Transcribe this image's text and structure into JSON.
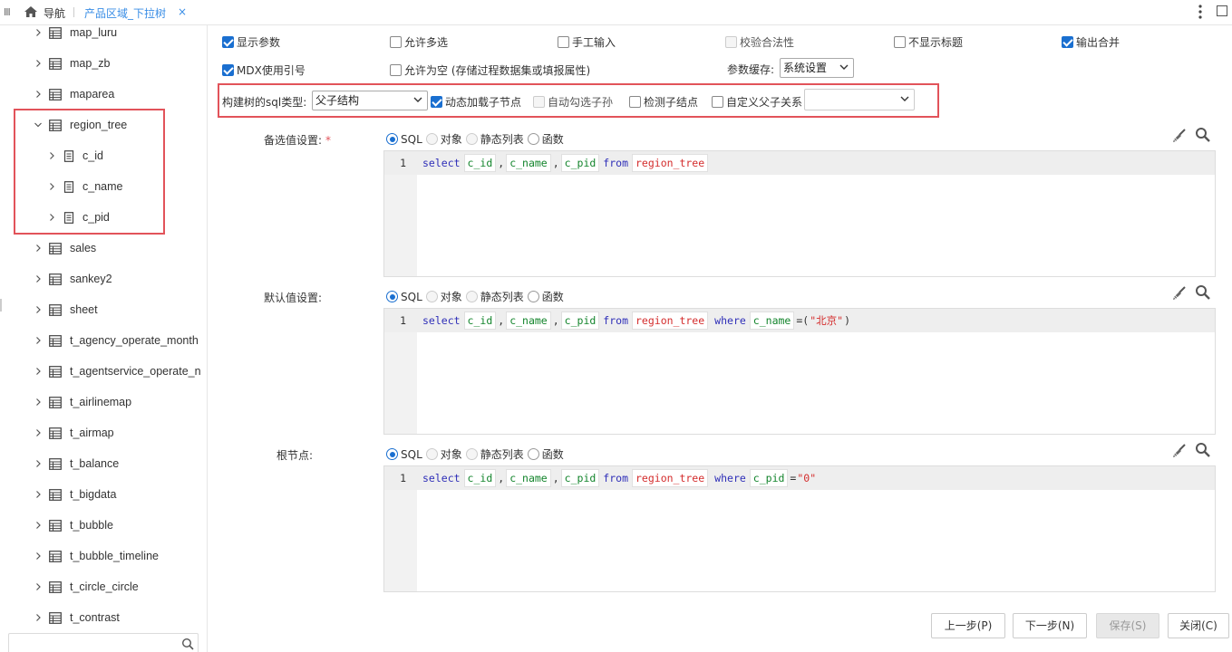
{
  "topbar": {
    "nav_label": "导航",
    "tab_label": "产品区域_下拉树",
    "tab_close": "×"
  },
  "tree": {
    "items": [
      {
        "label": "map_luru",
        "level": 0,
        "expanded": false
      },
      {
        "label": "map_zb",
        "level": 0,
        "expanded": false
      },
      {
        "label": "maparea",
        "level": 0,
        "expanded": false
      },
      {
        "label": "region_tree",
        "level": 0,
        "expanded": true
      },
      {
        "label": "c_id",
        "level": 1,
        "expanded": false
      },
      {
        "label": "c_name",
        "level": 1,
        "expanded": false
      },
      {
        "label": "c_pid",
        "level": 1,
        "expanded": false
      },
      {
        "label": "sales",
        "level": 0,
        "expanded": false
      },
      {
        "label": "sankey2",
        "level": 0,
        "expanded": false
      },
      {
        "label": "sheet",
        "level": 0,
        "expanded": false
      },
      {
        "label": "t_agency_operate_month",
        "level": 0,
        "expanded": false
      },
      {
        "label": "t_agentservice_operate_n",
        "level": 0,
        "expanded": false
      },
      {
        "label": "t_airlinemap",
        "level": 0,
        "expanded": false
      },
      {
        "label": "t_airmap",
        "level": 0,
        "expanded": false
      },
      {
        "label": "t_balance",
        "level": 0,
        "expanded": false
      },
      {
        "label": "t_bigdata",
        "level": 0,
        "expanded": false
      },
      {
        "label": "t_bubble",
        "level": 0,
        "expanded": false
      },
      {
        "label": "t_bubble_timeline",
        "level": 0,
        "expanded": false
      },
      {
        "label": "t_circle_circle",
        "level": 0,
        "expanded": false
      },
      {
        "label": "t_contrast",
        "level": 0,
        "expanded": false
      }
    ],
    "search_placeholder": ""
  },
  "options": {
    "show_param": {
      "label": "显示参数",
      "checked": true
    },
    "allow_multi": {
      "label": "允许多选",
      "checked": false
    },
    "manual_input": {
      "label": "手工输入",
      "checked": false
    },
    "validate": {
      "label": "校验合法性",
      "checked": false,
      "disabled": true
    },
    "hide_title": {
      "label": "不显示标题",
      "checked": false
    },
    "output_merge": {
      "label": "输出合并",
      "checked": true
    },
    "mdx_quote": {
      "label": "MDX使用引号",
      "checked": true
    },
    "allow_empty": {
      "label": "允许为空 (存储过程数据集或填报属性)",
      "checked": false
    },
    "cache_label": "参数缓存:",
    "cache_value": "系统设置"
  },
  "tree_row": {
    "sql_type_label": "构建树的sql类型:",
    "sql_type_value": "父子结构",
    "dynamic_load": {
      "label": "动态加载子节点",
      "checked": true
    },
    "auto_check": {
      "label": "自动勾选子孙",
      "checked": false,
      "disabled": true
    },
    "detect_leaf": {
      "label": "检测子结点",
      "checked": false
    },
    "custom_relation": {
      "label": "自定义父子关系",
      "checked": false
    },
    "custom_relation_value": ""
  },
  "sections": [
    {
      "label": "备选值设置:",
      "required": "*",
      "radios": [
        "SQL",
        "对象",
        "静态列表",
        "函数"
      ],
      "selected": "SQL",
      "line_no": "1",
      "code": {
        "select": "select",
        "fields": [
          "c_id",
          "c_name",
          "c_pid"
        ],
        "from": "from",
        "table": "region_tree",
        "where": "",
        "cond_field": "",
        "cond_rest": ""
      }
    },
    {
      "label": "默认值设置:",
      "required": "",
      "radios": [
        "SQL",
        "对象",
        "静态列表",
        "函数"
      ],
      "selected": "SQL",
      "line_no": "1",
      "code": {
        "select": "select",
        "fields": [
          "c_id",
          "c_name",
          "c_pid"
        ],
        "from": "from",
        "table": "region_tree",
        "where": "where",
        "cond_field": "c_name",
        "cond_op": "=(",
        "cond_str": "\"北京\"",
        "cond_close": ")"
      }
    },
    {
      "label": "根节点:",
      "required": "",
      "radios": [
        "SQL",
        "对象",
        "静态列表",
        "函数"
      ],
      "selected": "SQL",
      "line_no": "1",
      "code": {
        "select": "select",
        "fields": [
          "c_id",
          "c_name",
          "c_pid"
        ],
        "from": "from",
        "table": "region_tree",
        "where": "where",
        "cond_field": "c_pid",
        "cond_op": "=",
        "cond_str": "\"0\"",
        "cond_close": ""
      }
    }
  ],
  "buttons": {
    "prev": "上一步(P)",
    "next": "下一步(N)",
    "save": "保存(S)",
    "close": "关闭(C)"
  },
  "colors": {
    "accent": "#1a6fd0",
    "highlight_border": "#e2535a",
    "tab_blue": "#3a8ee6",
    "keyword": "#2f2fb8",
    "field": "#12842b",
    "table": "#d42d2d"
  }
}
